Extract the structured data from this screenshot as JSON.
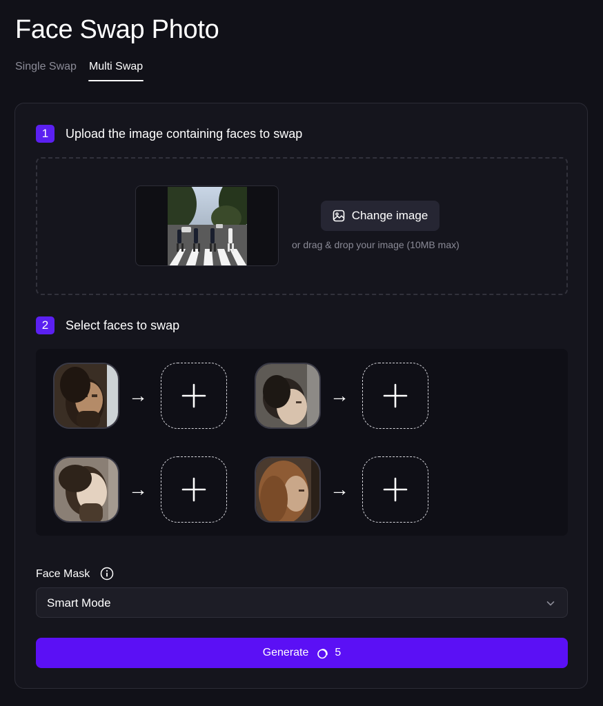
{
  "page": {
    "title": "Face Swap Photo",
    "tabs": [
      {
        "label": "Single Swap",
        "active": false
      },
      {
        "label": "Multi Swap",
        "active": true
      }
    ]
  },
  "step1": {
    "number": "1",
    "label": "Upload the image containing faces to swap",
    "change_button": "Change image",
    "hint": "or drag & drop your image (10MB max)"
  },
  "step2": {
    "number": "2",
    "label": "Select faces to swap",
    "faces": [
      {
        "name": "face-1",
        "add_icon": "plus-icon"
      },
      {
        "name": "face-2",
        "add_icon": "plus-icon"
      },
      {
        "name": "face-3",
        "add_icon": "plus-icon"
      },
      {
        "name": "face-4",
        "add_icon": "plus-icon"
      }
    ],
    "arrow": "→"
  },
  "face_mask": {
    "label": "Face Mask",
    "selected": "Smart Mode"
  },
  "generate": {
    "label": "Generate",
    "cost": "5",
    "cost_icon": "coin-icon"
  },
  "colors": {
    "background": "#111118",
    "card": "#15151d",
    "accent": "#5b10f5",
    "badge": "#5b20f1"
  }
}
